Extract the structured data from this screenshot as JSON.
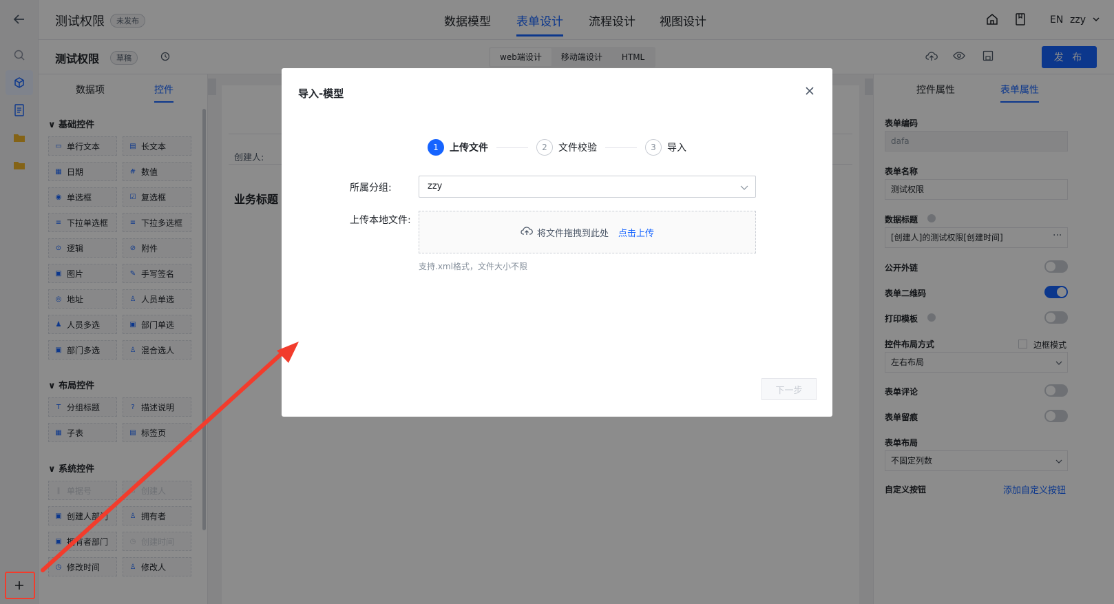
{
  "header": {
    "app_title": "测试权限",
    "status_badge": "未发布",
    "nav": [
      "数据模型",
      "表单设计",
      "流程设计",
      "视图设计"
    ],
    "lang": "EN",
    "user": "zzy"
  },
  "subbar": {
    "form_title": "测试权限",
    "draft_badge": "草稿",
    "modes": [
      "web端设计",
      "移动端设计",
      "HTML"
    ],
    "publish_label": "发 布"
  },
  "left_panel": {
    "tabs": [
      "数据项",
      "控件"
    ],
    "groups": [
      {
        "title": "基础控件",
        "items": [
          {
            "label": "单行文本",
            "icon": "text-line-icon",
            "disabled": false
          },
          {
            "label": "长文本",
            "icon": "text-area-icon",
            "disabled": false
          },
          {
            "label": "日期",
            "icon": "calendar-icon",
            "disabled": false
          },
          {
            "label": "数值",
            "icon": "number-icon",
            "disabled": false
          },
          {
            "label": "单选框",
            "icon": "radio-icon",
            "disabled": false
          },
          {
            "label": "复选框",
            "icon": "checkbox-icon",
            "disabled": false
          },
          {
            "label": "下拉单选框",
            "icon": "list-icon",
            "disabled": false
          },
          {
            "label": "下拉多选框",
            "icon": "list-icon",
            "disabled": false
          },
          {
            "label": "逻辑",
            "icon": "toggle-icon",
            "disabled": false
          },
          {
            "label": "附件",
            "icon": "paperclip-icon",
            "disabled": false
          },
          {
            "label": "图片",
            "icon": "image-icon",
            "disabled": false
          },
          {
            "label": "手写签名",
            "icon": "pen-icon",
            "disabled": false
          },
          {
            "label": "地址",
            "icon": "location-icon",
            "disabled": false
          },
          {
            "label": "人员单选",
            "icon": "user-icon",
            "disabled": false
          },
          {
            "label": "人员多选",
            "icon": "users-icon",
            "disabled": false
          },
          {
            "label": "部门单选",
            "icon": "department-icon",
            "disabled": false
          },
          {
            "label": "部门多选",
            "icon": "department-icon",
            "disabled": false
          },
          {
            "label": "混合选人",
            "icon": "user-icon",
            "disabled": false
          }
        ]
      },
      {
        "title": "布局控件",
        "items": [
          {
            "label": "分组标题",
            "icon": "title-icon",
            "disabled": false
          },
          {
            "label": "描述说明",
            "icon": "help-icon",
            "disabled": false
          },
          {
            "label": "子表",
            "icon": "table-icon",
            "disabled": false
          },
          {
            "label": "标签页",
            "icon": "tabs-icon",
            "disabled": false
          }
        ]
      },
      {
        "title": "系统控件",
        "items": [
          {
            "label": "单据号",
            "icon": "barcode-icon",
            "disabled": true
          },
          {
            "label": "创建人",
            "icon": "user-icon",
            "disabled": true
          },
          {
            "label": "创建人部门",
            "icon": "department-icon",
            "disabled": false
          },
          {
            "label": "拥有者",
            "icon": "user-icon",
            "disabled": false
          },
          {
            "label": "拥有者部门",
            "icon": "department-icon",
            "disabled": false
          },
          {
            "label": "创建时间",
            "icon": "clock-icon",
            "disabled": true
          },
          {
            "label": "修改时间",
            "icon": "clock-icon",
            "disabled": false
          },
          {
            "label": "修改人",
            "icon": "user-icon",
            "disabled": false
          }
        ]
      }
    ]
  },
  "canvas": {
    "creator_label": "创建人:",
    "section_title": "业务标题"
  },
  "right_panel": {
    "tabs": [
      "控件属性",
      "表单属性"
    ],
    "form_code_label": "表单编码",
    "form_code_value": "dafa",
    "form_name_label": "表单名称",
    "form_name_value": "测试权限",
    "data_title_label": "数据标题",
    "data_title_value": "[创建人]的测试权限[创建时间]",
    "public_link_label": "公开外链",
    "qrcode_label": "表单二维码",
    "print_label": "打印模板",
    "layout_mode_label": "控件布局方式",
    "border_mode_label": "边框模式",
    "layout_mode_value": "左右布局",
    "comment_label": "表单评论",
    "trace_label": "表单留痕",
    "form_layout_label": "表单布局",
    "form_layout_value": "不固定列数",
    "custom_btn_label": "自定义按钮",
    "custom_btn_link": "添加自定义按钮",
    "switches": {
      "public_link": false,
      "qrcode": true,
      "print": false,
      "comment": false,
      "trace": false
    }
  },
  "modal": {
    "title": "导入-模型",
    "steps": [
      {
        "num": "1",
        "label": "上传文件",
        "active": true
      },
      {
        "num": "2",
        "label": "文件校验",
        "active": false
      },
      {
        "num": "3",
        "label": "导入",
        "active": false
      }
    ],
    "group_label": "所属分组:",
    "group_value": "zzy",
    "upload_label": "上传本地文件:",
    "upload_text": "将文件拖拽到此处",
    "upload_link": "点击上传",
    "upload_hint": "支持.xml格式，文件大小不限",
    "next_label": "下一步"
  },
  "colors": {
    "accent": "#1664ff",
    "annotation": "#f23c2c"
  }
}
